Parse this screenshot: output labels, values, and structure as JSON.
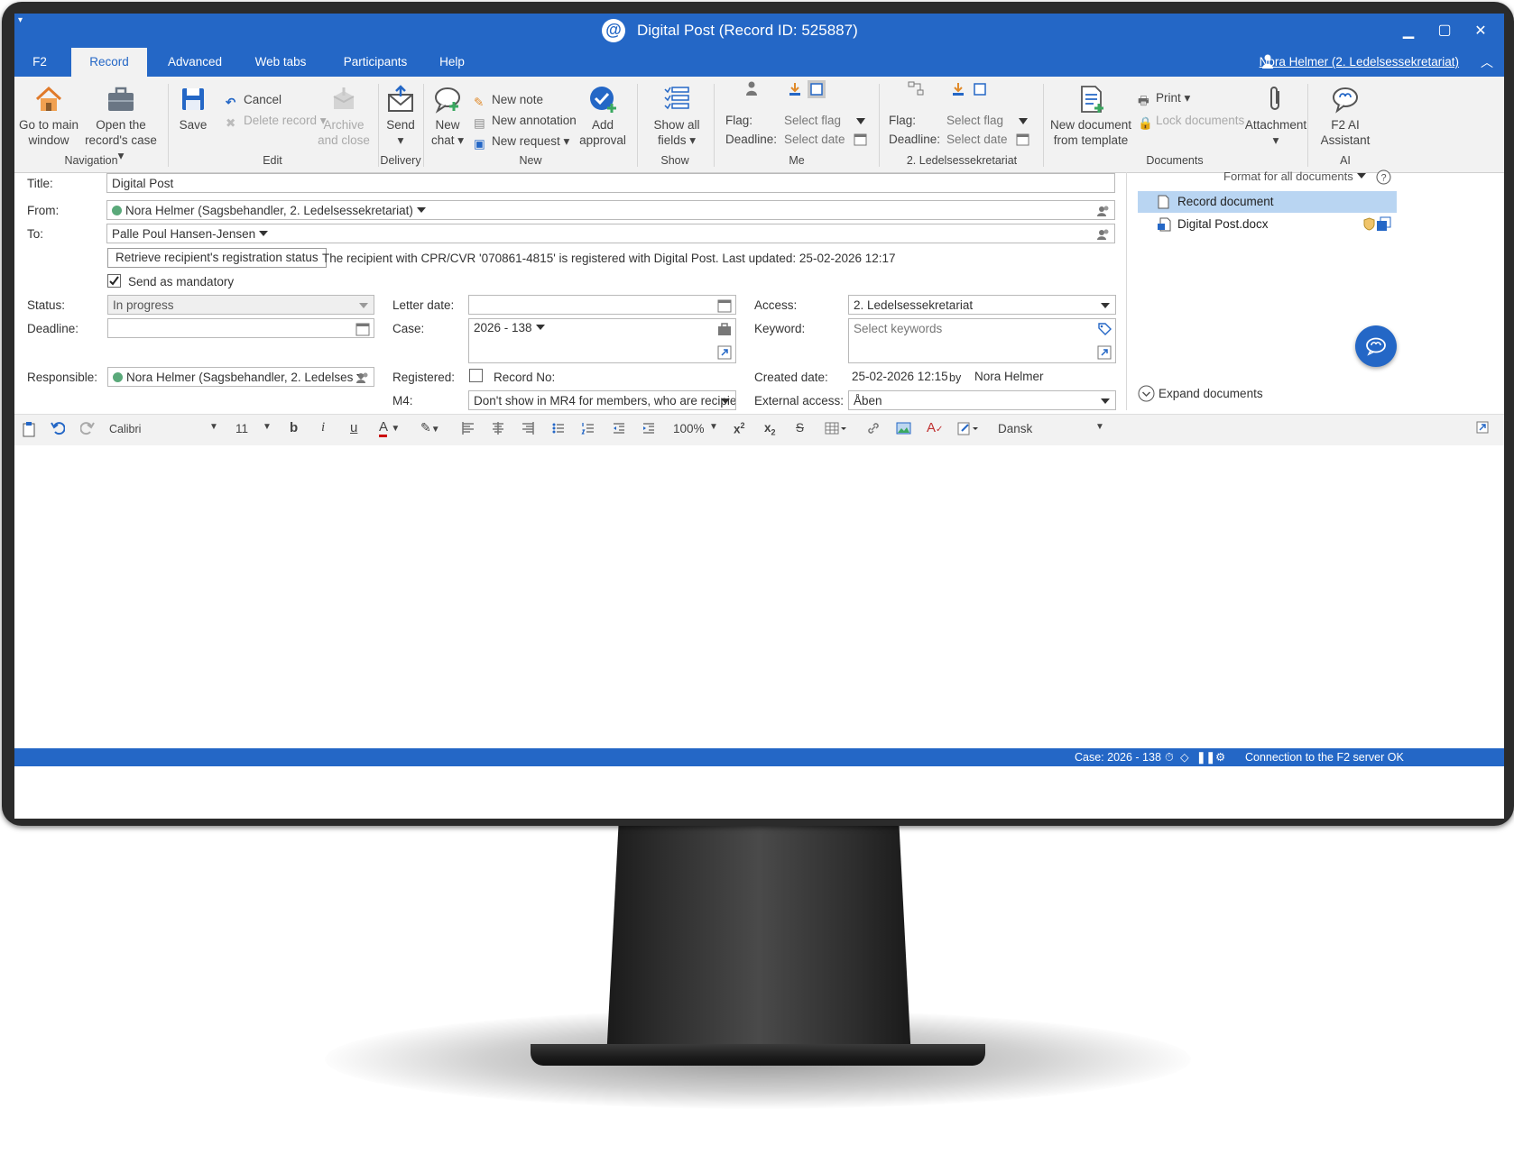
{
  "window": {
    "title": "Digital Post (Record ID: 525887)",
    "app_icon": "at-sign-icon",
    "controls": [
      "minimize-icon",
      "maximize-icon",
      "close-icon"
    ]
  },
  "menu": {
    "tabs": [
      "F2",
      "Record",
      "Advanced",
      "Web tabs",
      "Participants",
      "Help"
    ],
    "active_tab": "Record",
    "user": "Nora Helmer (2. Ledelsessekretariat)"
  },
  "ribbon": {
    "navigation": {
      "go_main_1": "Go to main",
      "go_main_2": "window",
      "open_case_1": "Open the",
      "open_case_2": "record's case",
      "label": "Navigation"
    },
    "edit": {
      "save": "Save",
      "cancel": "Cancel",
      "delete": "Delete record",
      "archive_1": "Archive",
      "archive_2": "and close",
      "label": "Edit"
    },
    "delivery": {
      "send": "Send",
      "label": "Delivery"
    },
    "new": {
      "chat_1": "New",
      "chat_2": "chat",
      "note": "New note",
      "annotation": "New annotation",
      "request": "New request",
      "approval_1": "Add",
      "approval_2": "approval",
      "label": "New"
    },
    "show": {
      "fields_1": "Show all",
      "fields_2": "fields",
      "label": "Show"
    },
    "me": {
      "flag_label": "Flag:",
      "flag_value": "Select flag",
      "deadline_label": "Deadline:",
      "deadline_value": "Select date",
      "label": "Me"
    },
    "unit": {
      "flag_label": "Flag:",
      "flag_value": "Select flag",
      "deadline_label": "Deadline:",
      "deadline_value": "Select date",
      "label": "2. Ledelsessekretariat"
    },
    "documents": {
      "new_doc_1": "New document",
      "new_doc_2": "from template",
      "print": "Print",
      "lock": "Lock documents",
      "attachment": "Attachment",
      "label": "Documents"
    },
    "ai": {
      "assistant_1": "F2 AI",
      "assistant_2": "Assistant",
      "label": "AI"
    }
  },
  "form": {
    "title_label": "Title:",
    "title_value": "Digital Post",
    "from_label": "From:",
    "from_value": "Nora Helmer (Sagsbehandler, 2. Ledelsessekretariat)",
    "to_label": "To:",
    "to_value": "Palle Poul Hansen-Jensen",
    "retrieve_button": "Retrieve recipient's registration status",
    "registration_info": "The recipient with CPR/CVR '070861-4815' is registered with Digital Post. Last updated: 25-02-2026 12:17",
    "mandatory_label": "Send as mandatory",
    "mandatory_checked": true,
    "status_label": "Status:",
    "status_value": "In progress",
    "deadline_label": "Deadline:",
    "deadline_value": "",
    "responsible_label": "Responsible:",
    "responsible_value": "Nora Helmer (Sagsbehandler, 2. Ledelses",
    "letter_date_label": "Letter date:",
    "letter_date_value": "",
    "case_label": "Case:",
    "case_value": "2026 - 138",
    "registered_label": "Registered:",
    "record_no_label": "Record No:",
    "m4_label": "M4:",
    "m4_value": "Don't show in MR4 for members, who are recipie",
    "access_label": "Access:",
    "access_value": "2. Ledelsessekretariat",
    "keyword_label": "Keyword:",
    "keyword_placeholder": "Select keywords",
    "created_label": "Created date:",
    "created_value": "25-02-2026 12:15",
    "created_by": "by",
    "created_user": "Nora Helmer",
    "external_label": "External access:",
    "external_value": "Åben"
  },
  "documents_panel": {
    "format_all": "Format for all documents",
    "items": [
      "Record document",
      "Digital Post.docx"
    ],
    "expand": "Expand documents"
  },
  "editor": {
    "font": "Calibri",
    "size": "11",
    "zoom": "100%",
    "language": "Dansk"
  },
  "status_bar": {
    "case": "Case: 2026 - 138",
    "connection": "Connection to the F2 server OK"
  },
  "colors": {
    "accent": "#2467c6",
    "ribbon_bg": "#f2f2f2",
    "selection": "#b9d5f2",
    "status_dot": "#5aa97a"
  }
}
